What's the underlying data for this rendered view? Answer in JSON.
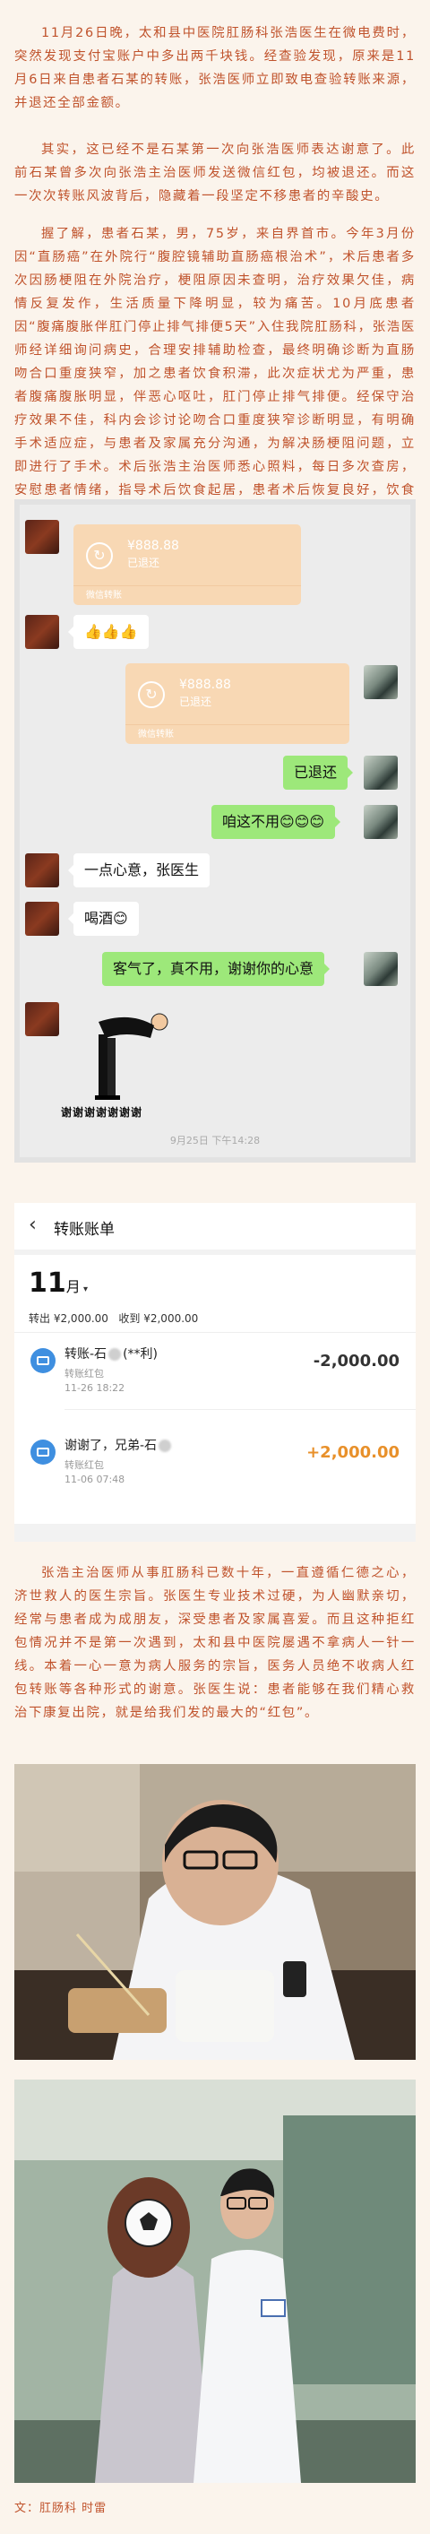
{
  "article": {
    "p1": "11月26日晚，太和县中医院肛肠科张浩医生在微电费时，突然发现支付宝账户中多出两千块钱。经查验发现，原来是11月6日来自患者石某的转账，张浩医师立即致电查验转账来源，并退还全部金额。",
    "p2": "其实，这已经不是石某第一次向张浩医师表达谢意了。此前石某曾多次向张浩主治医师发送微信红包，均被退还。而这一次次转账风波背后，隐藏着一段坚定不移患者的辛酸史。",
    "p3": "握了解，患者石某，男，75岁，来自界首市。今年3月份因“直肠癌”在外院行“腹腔镜辅助直肠癌根治术”，术后患者多次因肠梗阻在外院治疗，梗阻原因未查明，治疗效果欠佳，病情反复发作，生活质量下降明显，较为痛苦。10月底患者因“腹痛腹胀伴肛门停止排气排便5天”入住我院肛肠科，张浩医师经详细询问病史，合理安排辅助检查，最终明确诊断为直肠吻合口重度狭窄，加之患者饮食积滞，此次症状尤为严重，患者腹痛腹胀明显，伴恶心呕吐，肛门停止排气排便。经保守治疗效果不佳，科内会诊讨论吻合口重度狭窄诊断明显，有明确手术适应症，与患者及家属充分沟通，为解决肠梗阻问题，立即进行了手术。术后张浩主治医师悉心照料，每日多次查房，安慰患者情绪，指导术后饮食起居，患者术后恢复良好，饮食可，二便顺畅。",
    "p4": "张浩主治医师从事肛肠科已数十年，一直遵循仁德之心，济世救人的医生宗旨。张医生专业技术过硬，为人幽默亲切，经常与患者成为成朋友，深受患者及家属喜爱。而且这种拒红包情况并不是第一次遇到，太和县中医院屡遇不拿病人一针一线。本着一心一意为病人服务的宗旨，医务人员绝不收病人红包转账等各种形式的谢意。张医生说：患者能够在我们精心救治下康复出院，就是给我们发的最大的“红包”。",
    "credit": "文：肛肠科  时雷"
  },
  "chat": {
    "redpacket1_amount": "¥888.88",
    "redpacket1_status": "已退还",
    "redpacket_foot": "微信转账",
    "emoji_msg": "👍👍👍",
    "redpacket2_amount": "¥888.88",
    "redpacket2_status": "已退还",
    "msg_returned": "已退还",
    "msg_no_need": "咱这不用😊😊😊",
    "msg_thanks": "一点心意，张医生",
    "msg_drink": "喝酒😊",
    "msg_reply": "客气了，真不用，谢谢你的心意",
    "sticker_text": "谢谢谢谢谢谢谢",
    "timestamp": "9月25日 下午14:28"
  },
  "bill": {
    "title": "转账账单",
    "back_icon": "chevron-left-icon",
    "month": "11",
    "month_suffix": "月",
    "summary_out_label": "转出",
    "summary_out": "¥2,000.00",
    "summary_in_label": "收到",
    "summary_in": "¥2,000.00",
    "rows": [
      {
        "name": "转账-石",
        "name_suffix": "(**利)",
        "type": "转账红包",
        "date": "11-26 18:22",
        "amount": "-2,000.00",
        "color": "#333333"
      },
      {
        "name": "谢谢了，兄弟-石",
        "name_suffix": "",
        "type": "转账红包",
        "date": "11-06 07:48",
        "amount": "+2,000.00",
        "color": "#e8902a"
      }
    ]
  },
  "colors": {
    "text": "#c0532c",
    "page_bg": "#fbf4ec",
    "chat_green": "#9de87a"
  }
}
